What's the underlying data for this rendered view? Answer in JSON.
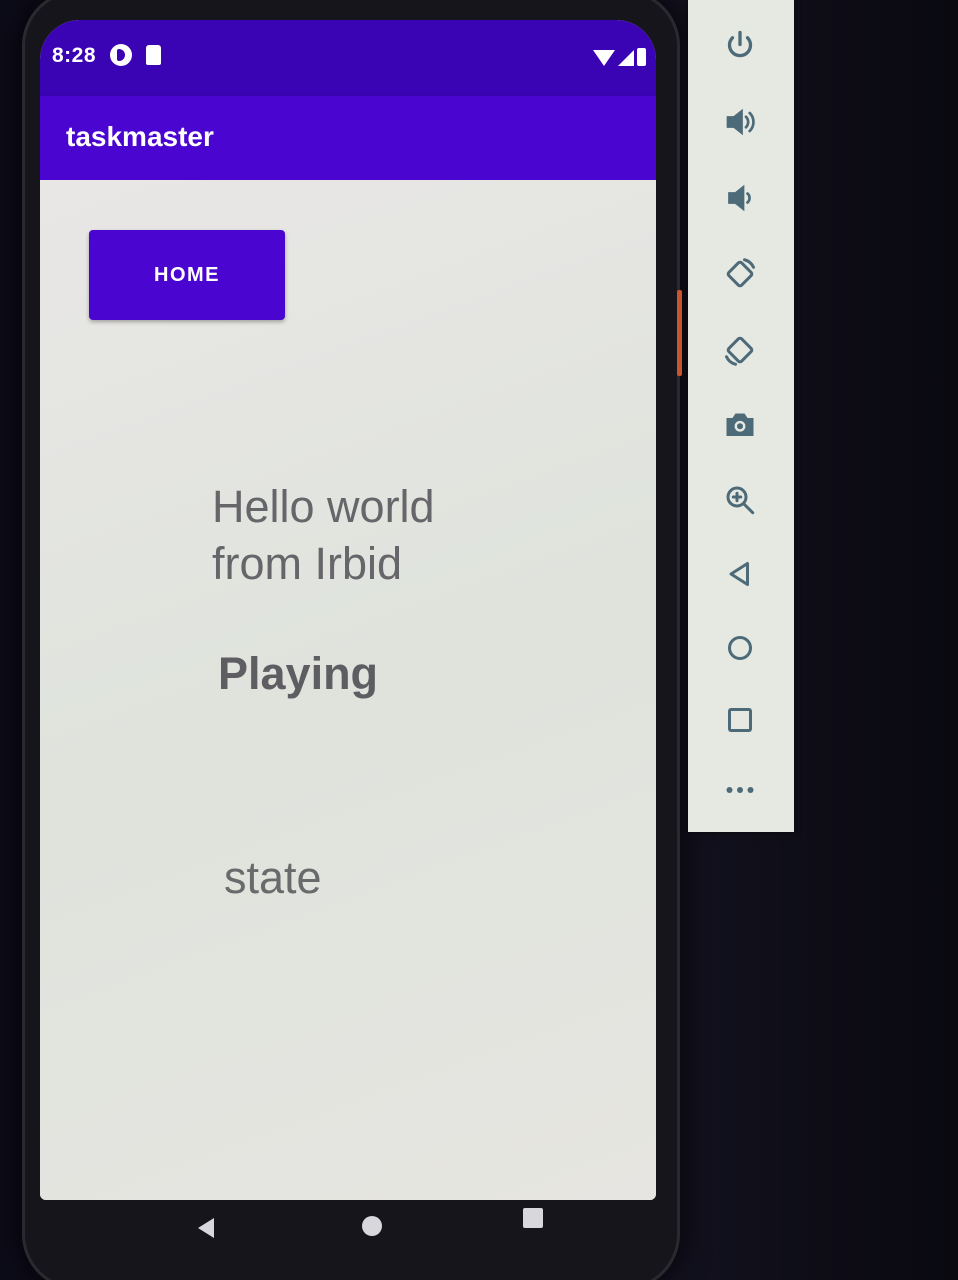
{
  "status_bar": {
    "time": "8:28"
  },
  "app_bar": {
    "title": "taskmaster"
  },
  "main": {
    "home_button_label": "HOME",
    "hello_text": "Hello world from Irbid",
    "playing_text": "Playing",
    "state_text": "state"
  },
  "colors": {
    "status_bar": "#3a03b4",
    "primary": "#4a05d0",
    "background": "#e4e3df",
    "text": "#666569"
  },
  "emulator_toolbar": {
    "icons": [
      "power-icon",
      "volume-up-icon",
      "volume-down-icon",
      "rotate-left-icon",
      "rotate-right-icon",
      "camera-icon",
      "zoom-in-icon",
      "back-icon",
      "home-icon",
      "overview-icon",
      "more-icon"
    ]
  },
  "nav_bar": {
    "icons": [
      "back-icon",
      "home-icon",
      "recents-icon"
    ]
  }
}
